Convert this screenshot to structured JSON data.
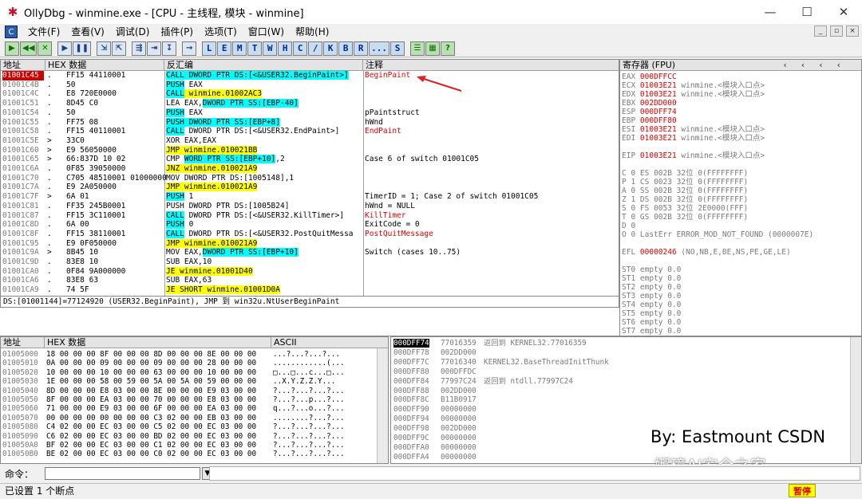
{
  "window": {
    "title": "OllyDbg - winmine.exe - [CPU - 主线程, 模块 - winmine]",
    "minimize": "—",
    "maximize": "☐",
    "close": "✕"
  },
  "menu": [
    "文件(F)",
    "查看(V)",
    "调试(D)",
    "插件(P)",
    "选项(T)",
    "窗口(W)",
    "帮助(H)"
  ],
  "mdi": [
    "_",
    "▫",
    "×"
  ],
  "toolbar": {
    "buttons": [
      "▶",
      "◀◀",
      "✕",
      "▶",
      "❚❚",
      "⇲",
      "⇱",
      "⇶",
      "⇥",
      "↧",
      "→"
    ],
    "letters": [
      "L",
      "E",
      "M",
      "T",
      "W",
      "H",
      "C",
      "/",
      "K",
      "B",
      "R",
      "...",
      "S"
    ],
    "extra": [
      "☰",
      "▦",
      "?"
    ]
  },
  "disasm": {
    "headers": [
      "地址",
      "HEX 数据",
      "反汇编",
      "注释"
    ],
    "rows": [
      {
        "addr": "01001C45",
        "mark": ".",
        "hex": "FF15 44110001",
        "asm_pre": "",
        "asm_hl": "CALL DWORD PTR DS:[<&USER32.BeginPaint>]",
        "hl": "cy",
        "asm_post": "",
        "cmt": "BeginPaint",
        "cmt_red": true,
        "sel": true
      },
      {
        "addr": "01001C4B",
        "mark": ".",
        "hex": "50",
        "asm_pre": "",
        "asm_hl": "PUSH",
        "hl": "cy",
        "asm_post": " EAX",
        "cmt": "",
        "cmt_red": false,
        "sel": false
      },
      {
        "addr": "01001C4C",
        "mark": ".",
        "hex": "E8 720E0000",
        "asm_pre": "",
        "asm_hl": "CALL",
        "hl": "cy",
        "asm_post": " winmine.01002AC3",
        "post_hl": true,
        "cmt": "",
        "cmt_red": false,
        "sel": false
      },
      {
        "addr": "01001C51",
        "mark": ".",
        "hex": "8D45 C0",
        "asm_pre": "LEA EAX,",
        "asm_hl": "DWORD PTR SS:[EBP-40]",
        "hl": "cy",
        "asm_post": "",
        "cmt": "",
        "cmt_red": false,
        "sel": false
      },
      {
        "addr": "01001C54",
        "mark": ".",
        "hex": "50",
        "asm_pre": "",
        "asm_hl": "PUSH",
        "hl": "cy",
        "asm_post": " EAX",
        "cmt": "pPaintstruct",
        "cmt_red": false,
        "sel": false
      },
      {
        "addr": "01001C55",
        "mark": ".",
        "hex": "FF75 08",
        "asm_pre": "",
        "asm_hl": "PUSH DWORD PTR SS:[EBP+8]",
        "hl": "cy",
        "asm_post": "",
        "cmt": "hWnd",
        "cmt_red": false,
        "sel": false
      },
      {
        "addr": "01001C58",
        "mark": ".",
        "hex": "FF15 40110001",
        "asm_pre": "",
        "asm_hl": "CALL",
        "hl": "cy",
        "asm_post": " DWORD PTR DS:[<&USER32.EndPaint>]",
        "cmt": "EndPaint",
        "cmt_red": true,
        "sel": false
      },
      {
        "addr": "01001C5E",
        "mark": ">",
        "hex": "33C0",
        "asm_pre": "XOR EAX,EAX",
        "asm_hl": "",
        "hl": "",
        "asm_post": "",
        "cmt": "",
        "cmt_red": false,
        "sel": false
      },
      {
        "addr": "01001C60",
        "mark": ">",
        "hex": "E9 56050000",
        "asm_pre": "",
        "asm_hl": "JMP",
        "hl": "hl",
        "asm_post": " winmine.010021BB",
        "post_hl": true,
        "cmt": "",
        "cmt_red": false,
        "sel": false
      },
      {
        "addr": "01001C65",
        "mark": ">",
        "hex": "66:837D 10 02",
        "asm_pre": "CMP ",
        "asm_hl": "WORD PTR SS:[EBP+10]",
        "hl": "cy",
        "asm_post": ",2",
        "cmt": "Case 6 of switch 01001C05",
        "cmt_red": false,
        "sel": false
      },
      {
        "addr": "01001C6A",
        "mark": ".",
        "hex": "0F85 39050000",
        "asm_pre": "",
        "asm_hl": "JNZ",
        "hl": "hl",
        "asm_post": " winmine.010021A9",
        "post_hl": true,
        "cmt": "",
        "cmt_red": false,
        "sel": false
      },
      {
        "addr": "01001C70",
        "mark": ".",
        "hex": "C705 48510001 01000000",
        "asm_pre": "MOV DWORD PTR DS:[1005148],1",
        "asm_hl": "",
        "hl": "",
        "asm_post": "",
        "cmt": "",
        "cmt_red": false,
        "sel": false
      },
      {
        "addr": "01001C7A",
        "mark": ".",
        "hex": "E9 2A050000",
        "asm_pre": "",
        "asm_hl": "JMP",
        "hl": "hl",
        "asm_post": " winmine.010021A9",
        "post_hl": true,
        "cmt": "",
        "cmt_red": false,
        "sel": false
      },
      {
        "addr": "01001C7F",
        "mark": ">",
        "hex": "6A 01",
        "asm_pre": "",
        "asm_hl": "PUSH",
        "hl": "cy",
        "asm_post": " 1",
        "cmt": "TimerID = 1; Case 2 of switch 01001C05",
        "cmt_red": false,
        "sel": false
      },
      {
        "addr": "01001C81",
        "mark": ".",
        "hex": "FF35 245B0001",
        "asm_pre": "PUSH DWORD PTR DS:[1005B24]",
        "asm_hl": "",
        "hl": "",
        "asm_post": "",
        "cmt": "hWnd = NULL",
        "cmt_red": false,
        "sel": false
      },
      {
        "addr": "01001C87",
        "mark": ".",
        "hex": "FF15 3C110001",
        "asm_pre": "",
        "asm_hl": "CALL",
        "hl": "cy",
        "asm_post": " DWORD PTR DS:[<&USER32.KillTimer>]",
        "cmt": "KillTimer",
        "cmt_red": true,
        "sel": false
      },
      {
        "addr": "01001C8D",
        "mark": ".",
        "hex": "6A 00",
        "asm_pre": "",
        "asm_hl": "PUSH",
        "hl": "cy",
        "asm_post": " 0",
        "cmt": "ExitCode = 0",
        "cmt_red": false,
        "sel": false
      },
      {
        "addr": "01001C8F",
        "mark": ".",
        "hex": "FF15 38110001",
        "asm_pre": "",
        "asm_hl": "CALL",
        "hl": "cy",
        "asm_post": " DWORD PTR DS:[<&USER32.PostQuitMessa",
        "cmt": "PostQuitMessage",
        "cmt_red": true,
        "sel": false
      },
      {
        "addr": "01001C95",
        "mark": ".",
        "hex": "E9 0F050000",
        "asm_pre": "",
        "asm_hl": "JMP",
        "hl": "hl",
        "asm_post": " winmine.010021A9",
        "post_hl": true,
        "cmt": "",
        "cmt_red": false,
        "sel": false
      },
      {
        "addr": "01001C9A",
        "mark": ">",
        "hex": "8B45 10",
        "asm_pre": "MOV EAX,",
        "asm_hl": "DWORD PTR SS:[EBP+10]",
        "hl": "cy",
        "asm_post": "",
        "cmt": "Switch (cases 10..75)",
        "cmt_red": false,
        "sel": false
      },
      {
        "addr": "01001C9D",
        "mark": ".",
        "hex": "83E8 10",
        "asm_pre": "SUB EAX,10",
        "asm_hl": "",
        "hl": "",
        "asm_post": "",
        "cmt": "",
        "cmt_red": false,
        "sel": false
      },
      {
        "addr": "01001CA0",
        "mark": ".",
        "hex": "0F84 9A000000",
        "asm_pre": "",
        "asm_hl": "JE",
        "hl": "hl",
        "asm_post": " winmine.01001D40",
        "post_hl": true,
        "cmt": "",
        "cmt_red": false,
        "sel": false
      },
      {
        "addr": "01001CA6",
        "mark": ".",
        "hex": "83E8 63",
        "asm_pre": "SUB EAX,63",
        "asm_hl": "",
        "hl": "",
        "asm_post": "",
        "cmt": "",
        "cmt_red": false,
        "sel": false
      },
      {
        "addr": "01001CA9",
        "mark": ".",
        "hex": "74 5F",
        "asm_pre": "",
        "asm_hl": "JE SHORT",
        "hl": "hl",
        "asm_post": " winmine.01001D0A",
        "post_hl": true,
        "cmt": "",
        "cmt_red": false,
        "sel": false
      }
    ]
  },
  "hint": "DS:[01001144]=77124920 (USER32.BeginPaint), JMP 到 win32u.NtUserBeginPaint",
  "registers": {
    "header": "寄存器 (FPU)",
    "rows": [
      {
        "n": "EAX",
        "v": "000DFFCC",
        "t": ""
      },
      {
        "n": "ECX",
        "v": "01003E21",
        "t": "winmine.<模块入口点>"
      },
      {
        "n": "EDX",
        "v": "01003E21",
        "t": "winmine.<模块入口点>"
      },
      {
        "n": "EBX",
        "v": "002DD000",
        "t": ""
      },
      {
        "n": "ESP",
        "v": "000DFF74",
        "t": ""
      },
      {
        "n": "EBP",
        "v": "000DFF80",
        "t": ""
      },
      {
        "n": "ESI",
        "v": "01003E21",
        "t": "winmine.<模块入口点>"
      },
      {
        "n": "EDI",
        "v": "01003E21",
        "t": "winmine.<模块入口点>"
      },
      {
        "n": "",
        "v": "",
        "t": ""
      },
      {
        "n": "EIP",
        "v": "01003E21",
        "t": "winmine.<模块入口点>"
      },
      {
        "n": "",
        "v": "",
        "t": ""
      },
      {
        "n": "C 0",
        "v": "",
        "t": "ES 002B 32位 0(FFFFFFFF)"
      },
      {
        "n": "P 1",
        "v": "",
        "t": "CS 0023 32位 0(FFFFFFFF)"
      },
      {
        "n": "A 0",
        "v": "",
        "t": "SS 002B 32位 0(FFFFFFFF)"
      },
      {
        "n": "Z 1",
        "v": "",
        "t": "DS 002B 32位 0(FFFFFFFF)"
      },
      {
        "n": "S 0",
        "v": "",
        "t": "FS 0053 32位 2E0000(FFF)"
      },
      {
        "n": "T 0",
        "v": "",
        "t": "GS 002B 32位 0(FFFFFFFF)"
      },
      {
        "n": "D 0",
        "v": "",
        "t": ""
      },
      {
        "n": "O 0",
        "v": "",
        "t": "LastErr ERROR_MOD_NOT_FOUND (0000007E)"
      },
      {
        "n": "",
        "v": "",
        "t": ""
      },
      {
        "n": "EFL",
        "v": "00000246",
        "t": "(NO,NB,E,BE,NS,PE,GE,LE)"
      },
      {
        "n": "",
        "v": "",
        "t": ""
      },
      {
        "n": "ST0",
        "v": "",
        "t": "empty 0.0"
      },
      {
        "n": "ST1",
        "v": "",
        "t": "empty 0.0"
      },
      {
        "n": "ST2",
        "v": "",
        "t": "empty 0.0"
      },
      {
        "n": "ST3",
        "v": "",
        "t": "empty 0.0"
      },
      {
        "n": "ST4",
        "v": "",
        "t": "empty 0.0"
      },
      {
        "n": "ST5",
        "v": "",
        "t": "empty 0.0"
      },
      {
        "n": "ST6",
        "v": "",
        "t": "empty 0.0"
      },
      {
        "n": "ST7",
        "v": "",
        "t": "empty 0.0"
      }
    ]
  },
  "dump": {
    "headers": [
      "地址",
      "HEX 数据",
      "ASCII"
    ],
    "rows": [
      {
        "a": "01005000",
        "h": "18 00 00 00 8F 00 00 00 8D 00 00 00 8E 00 00 00",
        "s": "...?...?...?..."
      },
      {
        "a": "01005010",
        "h": "0A 00 00 00 09 00 00 00 09 00 00 00 28 00 00 00",
        "s": "............(..."
      },
      {
        "a": "01005020",
        "h": "10 00 00 00 10 00 00 00 63 00 00 00 10 00 00 00",
        "s": "□...□...c...□..."
      },
      {
        "a": "01005030",
        "h": "1E 00 00 00 58 00 59 00 5A 00 5A 00 59 00 00 00",
        "s": "..X.Y.Z.Z.Y..."
      },
      {
        "a": "01005040",
        "h": "8D 00 00 00 E8 03 00 00 8E 00 00 00 E9 03 00 00",
        "s": "?...?...?...?..."
      },
      {
        "a": "01005050",
        "h": "8F 00 00 00 EA 03 00 00 70 00 00 00 E8 03 00 00",
        "s": "?...?...p...?..."
      },
      {
        "a": "01005060",
        "h": "71 00 00 00 E9 03 00 00 6F 00 00 00 EA 03 00 00",
        "s": "q...?...o...?..."
      },
      {
        "a": "01005070",
        "h": "00 00 00 00 00 00 00 00 C3 02 00 00 EB 03 00 00",
        "s": "........?...?..."
      },
      {
        "a": "01005080",
        "h": "C4 02 00 00 EC 03 00 00 C5 02 00 00 EC 03 00 00",
        "s": "?...?...?...?..."
      },
      {
        "a": "01005090",
        "h": "C6 02 00 00 EC 03 00 00 BD 02 00 00 EC 03 00 00",
        "s": "?...?...?...?..."
      },
      {
        "a": "010050A0",
        "h": "BF 02 00 00 EC 03 00 00 C1 02 00 00 EC 03 00 00",
        "s": "?...?...?...?..."
      },
      {
        "a": "010050B0",
        "h": "BE 02 00 00 EC 03 00 00 C0 02 00 00 EC 03 00 00",
        "s": "?...?...?...?..."
      }
    ]
  },
  "stack": {
    "rows": [
      {
        "a": "000DFF74",
        "v": "77016359",
        "t": "返回到 KERNEL32.77016359"
      },
      {
        "a": "000DFF78",
        "v": "002DD000",
        "t": ""
      },
      {
        "a": "000DFF7C",
        "v": "77016340",
        "t": "KERNEL32.BaseThreadInitThunk"
      },
      {
        "a": "000DFF80",
        "v": "000DFFDC",
        "t": ""
      },
      {
        "a": "000DFF84",
        "v": "77997C24",
        "t": "返回到 ntdll.77997C24"
      },
      {
        "a": "000DFF88",
        "v": "002DD000",
        "t": ""
      },
      {
        "a": "000DFF8C",
        "v": "B11B0917",
        "t": ""
      },
      {
        "a": "000DFF90",
        "v": "00000000",
        "t": ""
      },
      {
        "a": "000DFF94",
        "v": "00000000",
        "t": ""
      },
      {
        "a": "000DFF98",
        "v": "002DD000",
        "t": ""
      },
      {
        "a": "000DFF9C",
        "v": "00000000",
        "t": ""
      },
      {
        "a": "000DFFA0",
        "v": "00000000",
        "t": ""
      },
      {
        "a": "000DFFA4",
        "v": "00000000",
        "t": ""
      }
    ]
  },
  "watermark": {
    "line1": "By:  Eastmount CSDN",
    "line2": "娜璋AI安全之家"
  },
  "command": {
    "label": "命令：",
    "value": ""
  },
  "status": {
    "text": "已设置 1 个断点",
    "paused": "暂停"
  }
}
